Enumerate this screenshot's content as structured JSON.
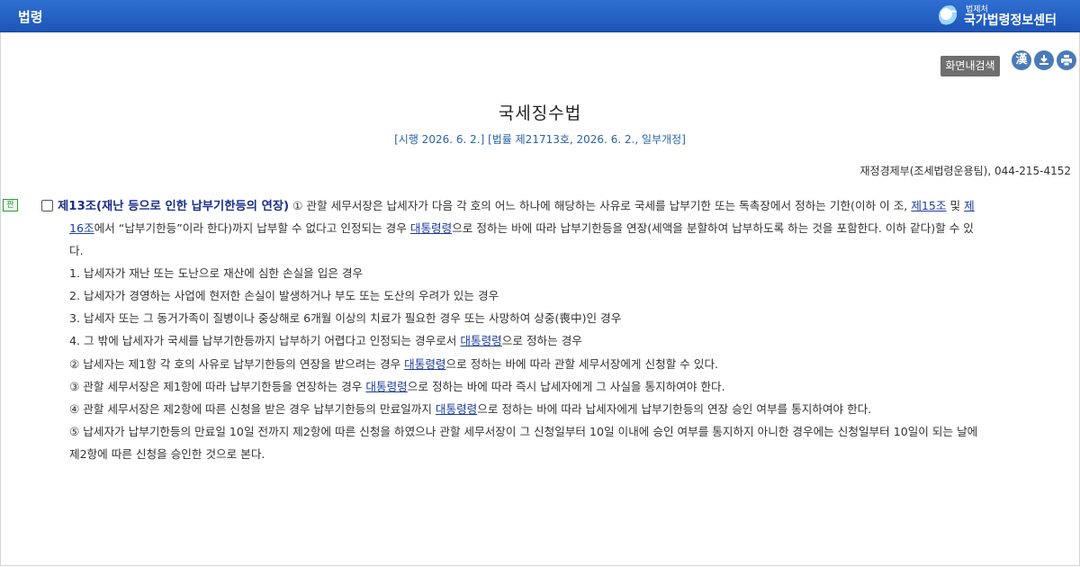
{
  "header": {
    "title": "법령",
    "logo_small": "법제처",
    "logo_big": "국가법령정보센터"
  },
  "toolbar": {
    "search_label": "화면내검색",
    "hanja_label": "漢",
    "download_icon": "download-icon",
    "print_icon": "print-icon"
  },
  "law": {
    "title": "국세징수법",
    "subtitle": "[시행 2026. 6. 2.] [법률 제21713호, 2026. 6. 2., 일부개정]",
    "department": "재정경제부(조세법령운용팀), 044-215-4152"
  },
  "article": {
    "badge": "판",
    "heading": "제13조(재난 등으로 인한 납부기한등의 연장)",
    "p1_a": " ① 관할 세무서장은 납세자가 다음 각 호의 어느 하나에 해당하는 사유로 국세를 납부기한 또는 독촉장에서 정하는 기한(이하 이 조, ",
    "link_15": "제15조",
    "p1_b": " 및 ",
    "link_16a": "제",
    "link_16b": "16조",
    "p1_c": "에서 “납부기한등”이라 한다)까지 납부할 수 없다고 인정되는 경우 ",
    "link_dv1": "대통령령",
    "p1_d": "으로 정하는 바에 따라 납부기한등을 연장(세액을 분할하여 납부하도록 하는 것을 포함한다. 이하 같다)할 수 있",
    "p1_e": "다.",
    "items": [
      "1. 납세자가 재난 또는 도난으로 재산에 심한 손실을 입은 경우",
      "2. 납세자가 경영하는 사업에 현저한 손실이 발생하거나 부도 또는 도산의 우려가 있는 경우",
      "3. 납세자 또는 그 동거가족이 질병이나 중상해로 6개월 이상의 치료가 필요한 경우 또는 사망하여 상중(喪中)인 경우"
    ],
    "item4_a": "4. 그 밖에 납세자가 국세를 납부기한등까지 납부하기 어렵다고 인정되는 경우로서 ",
    "item4_b": "으로 정하는 경우",
    "p2_a": "② 납세자는 제1항 각 호의 사유로 납부기한등의 연장을 받으려는 경우 ",
    "p2_b": "으로 정하는 바에 따라 관할 세무서장에게 신청할 수 있다.",
    "p3_a": "③ 관할 세무서장은 제1항에 따라 납부기한등을 연장하는 경우 ",
    "p3_b": "으로 정하는 바에 따라 즉시 납세자에게 그 사실을 통지하여야 한다.",
    "p4_a": "④ 관할 세무서장은 제2항에 따른 신청을 받은 경우 납부기한등의 만료일까지 ",
    "p4_b": "으로 정하는 바에 따라 납세자에게 납부기한등의 연장 승인 여부를 통지하여야 한다.",
    "p5_a": "⑤ 납세자가 납부기한등의 만료일 10일 전까지 제2항에 따른 신청을 하였으나 관할 세무서장이 그 신청일부터 10일 이내에 승인 여부를 통지하지 아니한 경우에는 신청일부터 10일이 되는 날에",
    "p5_b": "제2항에 따른 신청을 승인한 것으로 본다.",
    "decree": "대통령령"
  }
}
